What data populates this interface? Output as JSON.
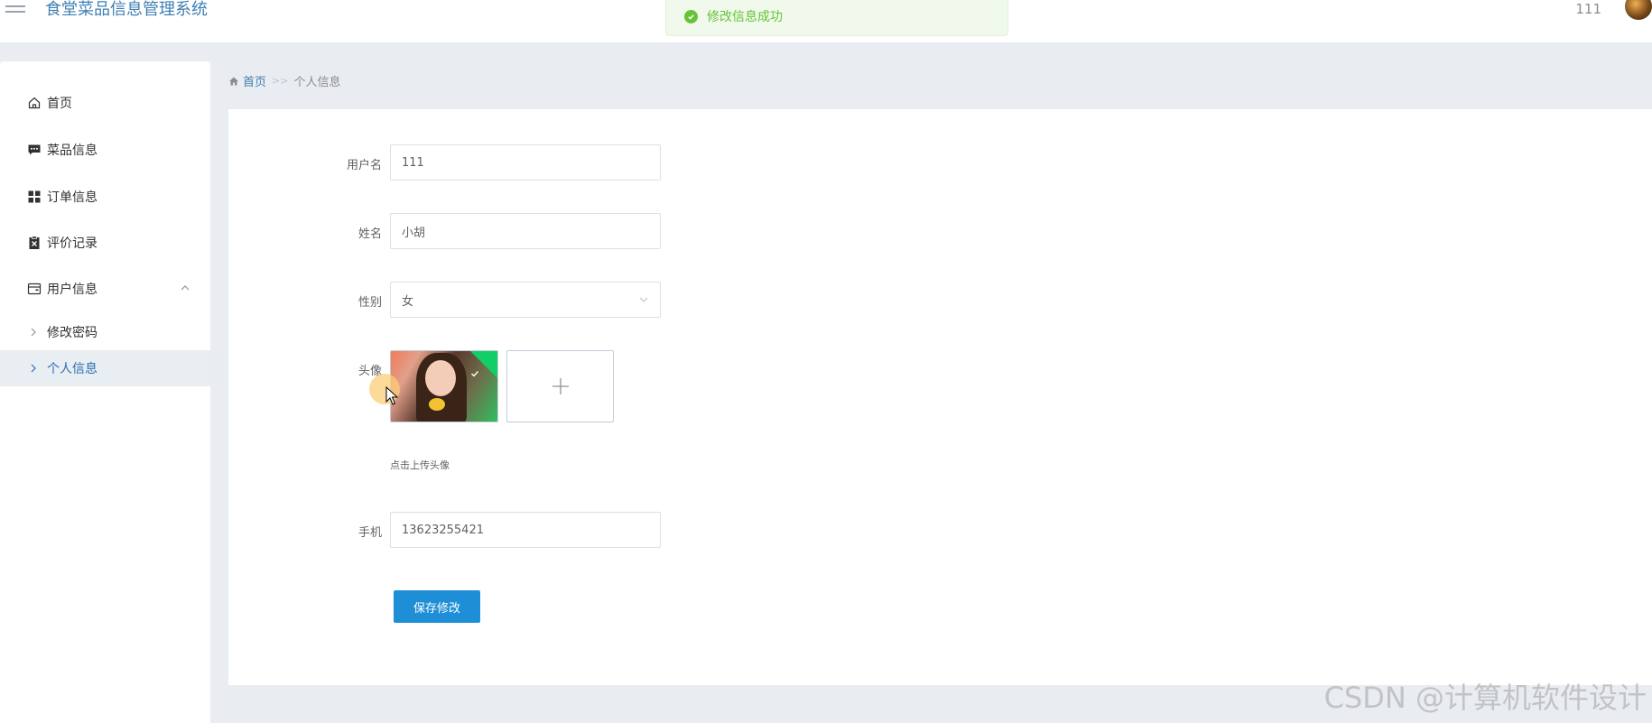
{
  "header": {
    "app_title": "食堂菜品信息管理系统",
    "user_name": "111"
  },
  "toast": {
    "message": "修改信息成功"
  },
  "sidebar": {
    "items": [
      {
        "label": "首页",
        "icon": "home-icon"
      },
      {
        "label": "菜品信息",
        "icon": "chat-icon"
      },
      {
        "label": "订单信息",
        "icon": "grid-icon"
      },
      {
        "label": "评价记录",
        "icon": "clipboard-icon"
      },
      {
        "label": "用户信息",
        "icon": "wallet-icon"
      }
    ],
    "sub_items": [
      {
        "label": "修改密码"
      },
      {
        "label": "个人信息"
      }
    ]
  },
  "breadcrumb": {
    "home": "首页",
    "separator": ">>",
    "current": "个人信息"
  },
  "form": {
    "username_label": "用户名",
    "username_value": "111",
    "name_label": "姓名",
    "name_value": "小胡",
    "gender_label": "性别",
    "gender_value": "女",
    "avatar_label": "头像",
    "avatar_tip": "点击上传头像",
    "phone_label": "手机",
    "phone_value": "13623255421",
    "save_label": "保存修改"
  },
  "watermark": "CSDN @计算机软件设计",
  "colors": {
    "accent": "#1e8fd6",
    "success": "#67c23a",
    "title": "#3f7fb3"
  }
}
